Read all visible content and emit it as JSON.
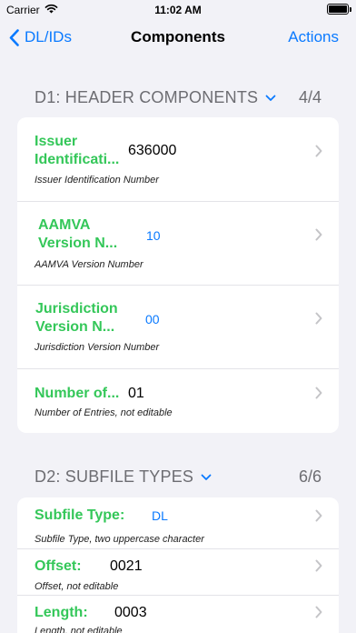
{
  "status": {
    "carrier": "Carrier",
    "time": "11:02 AM"
  },
  "nav": {
    "back_label": "DL/IDs",
    "title": "Components",
    "action_label": "Actions"
  },
  "sections": [
    {
      "title": "D1: HEADER COMPONENTS",
      "count": "4/4",
      "rows": [
        {
          "label": "Issuer Identificati...",
          "value": "636000",
          "desc": "Issuer Identification Number"
        },
        {
          "label": "AAMVA Version N...",
          "value": "10",
          "desc": "AAMVA Version Number"
        },
        {
          "label": "Jurisdiction Version N...",
          "value": "00",
          "desc": "Jurisdiction Version Number"
        },
        {
          "label": "Number of...",
          "value": "01",
          "desc": "Number of Entries, not editable"
        }
      ]
    },
    {
      "title": "D2: SUBFILE TYPES",
      "count": "6/6",
      "rows": [
        {
          "label": "Subfile Type:",
          "value": "DL",
          "desc": "Subfile Type, two uppercase character"
        },
        {
          "label": "Offset:",
          "value": "0021",
          "desc": "Offset, not editable"
        },
        {
          "label": "Length:",
          "value": "0003",
          "desc": "Length, not editable"
        }
      ]
    }
  ],
  "colors": {
    "accent": "#0a7aff",
    "label_green": "#34c759",
    "background": "#f2f2f7",
    "secondary_text": "#6d6d72"
  },
  "icons": {
    "back": "chevron-left-icon",
    "collapse": "chevron-down-icon",
    "disclosure": "chevron-right-icon"
  }
}
